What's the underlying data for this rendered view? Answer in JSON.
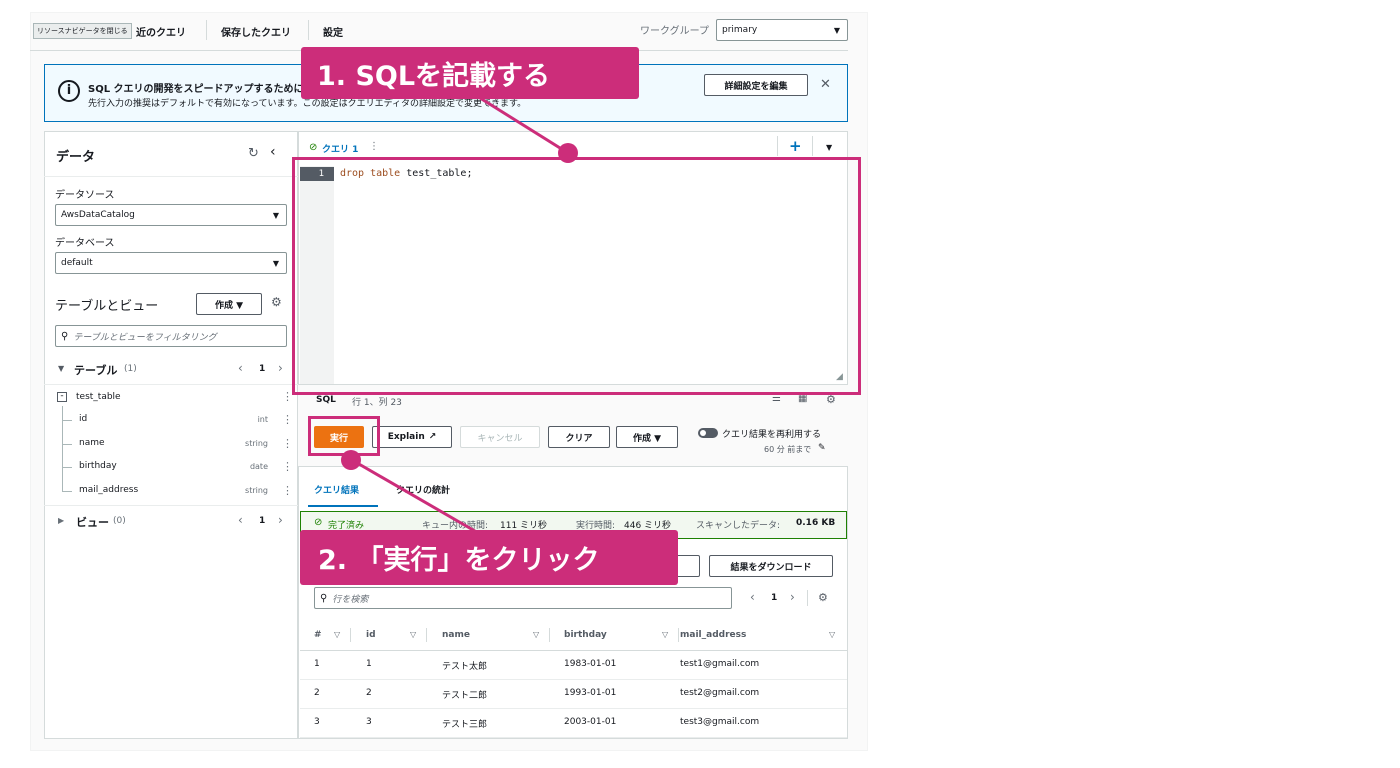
{
  "top_nav": {
    "tooltip": "リソースナビゲータを閉じる",
    "tab_recent": "近のクエリ",
    "tab_saved": "保存したクエリ",
    "tab_settings": "設定",
    "workgroup_label": "ワークグループ",
    "workgroup_value": "primary"
  },
  "banner": {
    "title": "SQL クエリの開発をスピードアップするために",
    "text": "先行入力の推奨はデフォルトで有効になっています。この設定はクエリエディタの詳細設定で変更できます。",
    "edit_button": "詳細設定を編集",
    "close": "✕"
  },
  "sidebar": {
    "title": "データ",
    "datasource_label": "データソース",
    "datasource_value": "AwsDataCatalog",
    "database_label": "データベース",
    "database_value": "default",
    "tables_views_title": "テーブルとビュー",
    "create_button": "作成 ▼",
    "filter_placeholder": "テーブルとビューをフィルタリング",
    "tables_label": "テーブル",
    "tables_count": "(1)",
    "tables_page": "1",
    "table_name": "test_table",
    "columns": [
      {
        "name": "id",
        "type": "int"
      },
      {
        "name": "name",
        "type": "string"
      },
      {
        "name": "birthday",
        "type": "date"
      },
      {
        "name": "mail_address",
        "type": "string"
      }
    ],
    "views_label": "ビュー",
    "views_count": "(0)",
    "views_page": "1"
  },
  "editor": {
    "query_tab": "クエリ 1",
    "line_number": "1",
    "code_keyword": "drop table",
    "code_rest": "test_table;",
    "status_lang": "SQL",
    "status_pos": "行 1、列 23"
  },
  "actions": {
    "run": "実行",
    "explain": "Explain",
    "cancel": "キャンセル",
    "clear": "クリア",
    "create": "作成 ▼",
    "reuse_label": "クエリ結果を再利用する",
    "reuse_sub": "60 分 前まで"
  },
  "results": {
    "tab_results": "クエリ結果",
    "tab_stats": "クエリの統計",
    "status_done": "完了済み",
    "queue_label": "キュー内の時間:",
    "queue_value": "111 ミリ秒",
    "exec_label": "実行時間:",
    "exec_value": "446 ミリ秒",
    "scan_label": "スキャンしたデータ:",
    "scan_value": "0.16 KB",
    "download_button": "結果をダウンロード",
    "search_placeholder": "行を検索",
    "page": "1",
    "headers": [
      "#",
      "id",
      "name",
      "birthday",
      "mail_address"
    ],
    "rows": [
      [
        "1",
        "1",
        "テスト太郎",
        "1983-01-01",
        "test1@gmail.com"
      ],
      [
        "2",
        "2",
        "テスト二郎",
        "1993-01-01",
        "test2@gmail.com"
      ],
      [
        "3",
        "3",
        "テスト三郎",
        "2003-01-01",
        "test3@gmail.com"
      ]
    ]
  },
  "annotations": {
    "step1": "1. SQLを記載する",
    "step2": "2. 「実行」をクリック"
  },
  "colors": {
    "accent": "#cc2d7a",
    "primary_button": "#ec7211",
    "link": "#0073bb",
    "success": "#1d8102"
  }
}
